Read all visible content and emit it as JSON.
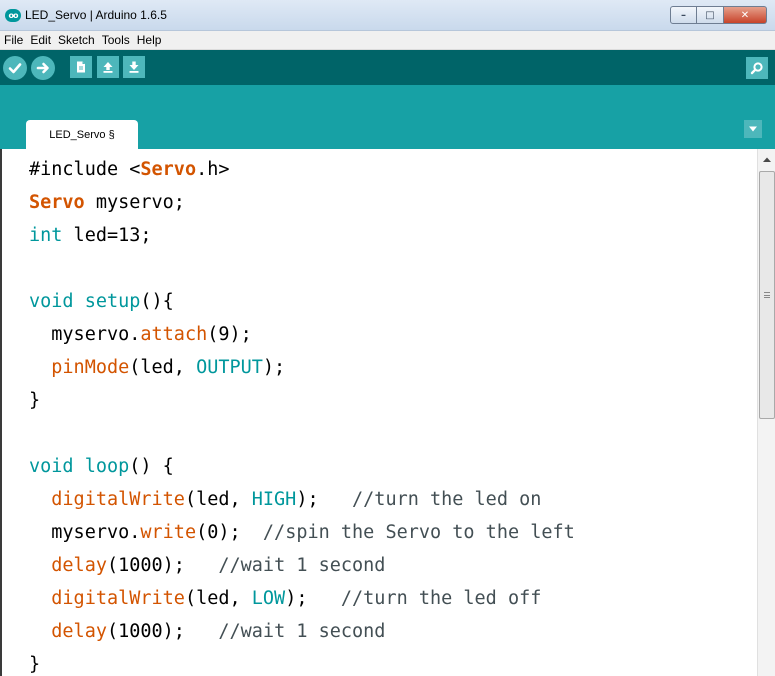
{
  "window": {
    "title": "LED_Servo | Arduino 1.6.5",
    "app_icon_glyph": "oo",
    "minimize_glyph": "–",
    "maximize_glyph": "□",
    "close_glyph": "✕"
  },
  "menu": [
    "File",
    "Edit",
    "Sketch",
    "Tools",
    "Help"
  ],
  "toolbar": {
    "buttons": [
      "verify-icon",
      "upload-icon",
      "new-icon",
      "open-icon",
      "save-icon"
    ],
    "serial_monitor": "serial-monitor-icon"
  },
  "tabs": [
    {
      "label": "LED_Servo §"
    }
  ],
  "colors": {
    "toolbar_bg": "#006468",
    "tabstrip_bg": "#17a1a5",
    "button_bg": "#4db7bb",
    "keyword": "#00979c",
    "function": "#d35400",
    "comment": "#434f54"
  },
  "code": [
    [
      [
        "plain",
        "#include <"
      ],
      [
        "bold",
        "Servo"
      ],
      [
        "plain",
        ".h>"
      ]
    ],
    [
      [
        "bold",
        "Servo"
      ],
      [
        "plain",
        " myservo;"
      ]
    ],
    [
      [
        "kw",
        "int"
      ],
      [
        "plain",
        " led=13;"
      ]
    ],
    [],
    [
      [
        "kw",
        "void"
      ],
      [
        "plain",
        " "
      ],
      [
        "kw",
        "setup"
      ],
      [
        "plain",
        "(){"
      ]
    ],
    [
      [
        "plain",
        "  myservo."
      ],
      [
        "fn",
        "attach"
      ],
      [
        "plain",
        "(9);"
      ]
    ],
    [
      [
        "plain",
        "  "
      ],
      [
        "fn",
        "pinMode"
      ],
      [
        "plain",
        "(led, "
      ],
      [
        "const",
        "OUTPUT"
      ],
      [
        "plain",
        ");"
      ]
    ],
    [
      [
        "plain",
        "}"
      ]
    ],
    [],
    [
      [
        "kw",
        "void"
      ],
      [
        "plain",
        " "
      ],
      [
        "kw",
        "loop"
      ],
      [
        "plain",
        "() {"
      ]
    ],
    [
      [
        "plain",
        "  "
      ],
      [
        "fn",
        "digitalWrite"
      ],
      [
        "plain",
        "(led, "
      ],
      [
        "const",
        "HIGH"
      ],
      [
        "plain",
        ");   "
      ],
      [
        "comment",
        "//turn the led on"
      ]
    ],
    [
      [
        "plain",
        "  myservo."
      ],
      [
        "fn",
        "write"
      ],
      [
        "plain",
        "(0);  "
      ],
      [
        "comment",
        "//spin the Servo to the left"
      ]
    ],
    [
      [
        "plain",
        "  "
      ],
      [
        "fn",
        "delay"
      ],
      [
        "plain",
        "(1000);   "
      ],
      [
        "comment",
        "//wait 1 second"
      ]
    ],
    [
      [
        "plain",
        "  "
      ],
      [
        "fn",
        "digitalWrite"
      ],
      [
        "plain",
        "(led, "
      ],
      [
        "const",
        "LOW"
      ],
      [
        "plain",
        ");   "
      ],
      [
        "comment",
        "//turn the led off"
      ]
    ],
    [
      [
        "plain",
        "  "
      ],
      [
        "fn",
        "delay"
      ],
      [
        "plain",
        "(1000);   "
      ],
      [
        "comment",
        "//wait 1 second"
      ]
    ],
    [
      [
        "plain",
        "}"
      ]
    ]
  ]
}
